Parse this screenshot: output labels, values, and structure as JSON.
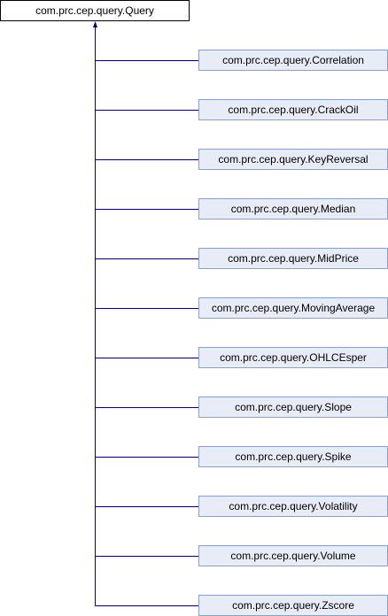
{
  "base_class": "com.prc.cep.query.Query",
  "derived_classes": [
    "com.prc.cep.query.Correlation",
    "com.prc.cep.query.CrackOil",
    "com.prc.cep.query.KeyReversal",
    "com.prc.cep.query.Median",
    "com.prc.cep.query.MidPrice",
    "com.prc.cep.query.MovingAverage",
    "com.prc.cep.query.OHLCEsper",
    "com.prc.cep.query.Slope",
    "com.prc.cep.query.Spike",
    "com.prc.cep.query.Volatility",
    "com.prc.cep.query.Volume",
    "com.prc.cep.query.Zscore"
  ],
  "colors": {
    "edge": "#000080",
    "node_fill": "#e8ecf6",
    "node_border": "#84a0d6"
  }
}
